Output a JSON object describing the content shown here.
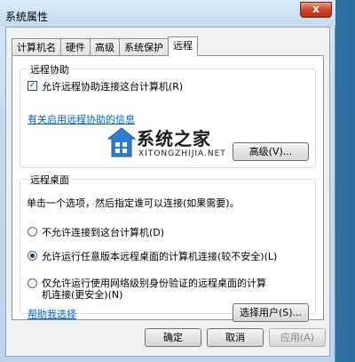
{
  "window": {
    "title": "系统属性",
    "close_glyph": "x"
  },
  "tabs": [
    {
      "label": "计算机名",
      "active": false
    },
    {
      "label": "硬件",
      "active": false
    },
    {
      "label": "高级",
      "active": false
    },
    {
      "label": "系统保护",
      "active": false
    },
    {
      "label": "远程",
      "active": true
    }
  ],
  "remote_assistance": {
    "title": "远程协助",
    "allow_checkbox_label": "允许远程协助连接这台计算机(R)",
    "allow_checked": true,
    "info_link": "有关启用远程协助的信息",
    "advanced_button": "高级(V)..."
  },
  "remote_desktop": {
    "title": "远程桌面",
    "instruction": "单击一个选项，然后指定谁可以连接(如果需要)。",
    "options": [
      {
        "label": "不允许连接到这台计算机(D)",
        "checked": false
      },
      {
        "label": "允许运行任意版本远程桌面的计算机连接(较不安全)(L)",
        "checked": true
      },
      {
        "label_line1": "仅允许运行使用网络级别身份验证的远程桌面的计算",
        "label_line2": "机连接(更安全)(N)",
        "checked": false
      }
    ],
    "help_link": "帮助我选择",
    "select_users_button": "选择用户(S)..."
  },
  "footer": {
    "ok": "确定",
    "cancel": "取消",
    "apply": "应用(A)",
    "apply_enabled": false
  },
  "watermark": {
    "brand": "系统之家",
    "domain": "XITONGZHIJIA.NET"
  },
  "colors": {
    "link": "#0066cc",
    "close_button": "#c8452c"
  }
}
